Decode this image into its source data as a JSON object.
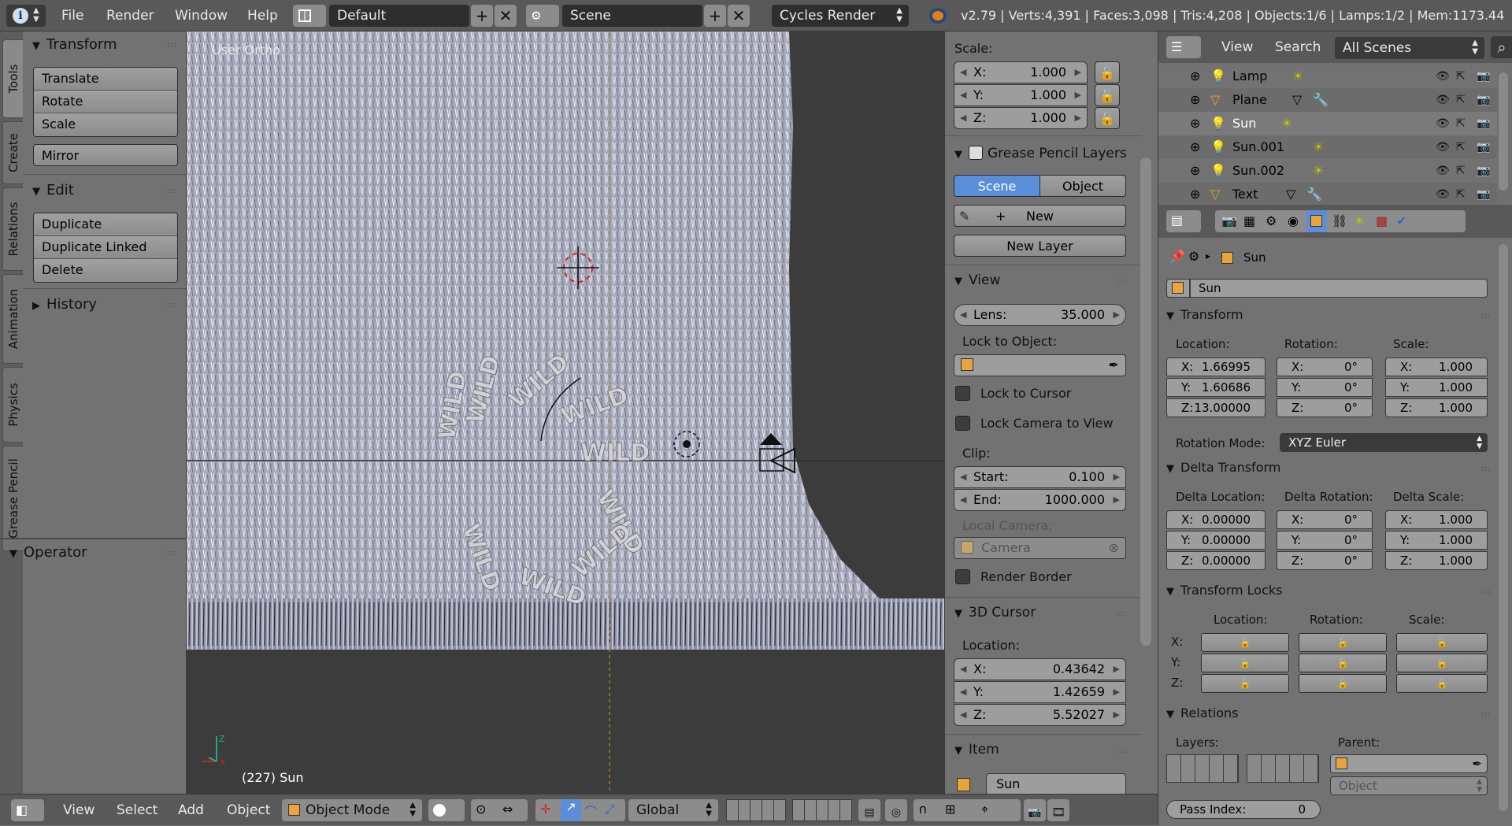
{
  "topbar": {
    "menus": [
      "File",
      "Render",
      "Window",
      "Help"
    ],
    "layout": "Default",
    "scene": "Scene",
    "engine": "Cycles Render",
    "stats": "v2.79 | Verts:4,391 | Faces:3,098 | Tris:4,208 | Objects:1/6 | Lamps:1/2 | Mem:1173.44"
  },
  "tool_tabs": [
    "Tools",
    "Create",
    "Relations",
    "Animation",
    "Physics",
    "Grease Pencil"
  ],
  "tools": {
    "transform_title": "Transform",
    "translate": "Translate",
    "rotate": "Rotate",
    "scale": "Scale",
    "mirror": "Mirror",
    "edit_title": "Edit",
    "duplicate": "Duplicate",
    "duplicate_linked": "Duplicate Linked",
    "delete": "Delete",
    "history_title": "History",
    "operator_title": "Operator"
  },
  "viewport": {
    "view_label": "User Ortho",
    "frame_info": "(227) Sun",
    "text_object": "WILD"
  },
  "nprops": {
    "scale_label": "Scale:",
    "scale_x": "1.000",
    "scale_y": "1.000",
    "scale_z": "1.000",
    "gp_title": "Grease Pencil Layers",
    "gp_scene": "Scene",
    "gp_object": "Object",
    "gp_new": "New",
    "gp_new_layer": "New Layer",
    "view_title": "View",
    "lens_label": "Lens:",
    "lens_value": "35.000",
    "lock_obj_label": "Lock to Object:",
    "lock_cursor": "Lock to Cursor",
    "lock_camera": "Lock Camera to View",
    "clip_label": "Clip:",
    "clip_start_label": "Start:",
    "clip_start": "0.100",
    "clip_end_label": "End:",
    "clip_end": "1000.000",
    "local_camera": "Local Camera:",
    "camera": "Camera",
    "render_border": "Render Border",
    "cursor_title": "3D Cursor",
    "location_label": "Location:",
    "cursor_x": "0.43642",
    "cursor_y": "1.42659",
    "cursor_z": "5.52027",
    "item_title": "Item",
    "item_name": "Sun"
  },
  "outliner": {
    "view": "View",
    "search": "Search",
    "filter": "All Scenes",
    "items": [
      "Lamp",
      "Plane",
      "Sun",
      "Sun.001",
      "Sun.002",
      "Text"
    ]
  },
  "props": {
    "breadcrumb_obj": "Sun",
    "name": "Sun",
    "transform_title": "Transform",
    "location_label": "Location:",
    "rotation_label": "Rotation:",
    "scale_label": "Scale:",
    "loc_x": "1.66995",
    "loc_y": "1.60686",
    "loc_z": "13.00000",
    "rot_x": "0°",
    "rot_y": "0°",
    "rot_z": "0°",
    "scl_x": "1.000",
    "scl_y": "1.000",
    "scl_z": "1.000",
    "rotation_mode_label": "Rotation Mode:",
    "rotation_mode": "XYZ Euler",
    "delta_title": "Delta Transform",
    "delta_location": "Delta Location:",
    "delta_rotation": "Delta Rotation:",
    "delta_scale": "Delta Scale:",
    "dloc_x": "0.00000",
    "dloc_y": "0.00000",
    "dloc_z": "0.00000",
    "drot_x": "0°",
    "drot_y": "0°",
    "drot_z": "0°",
    "dscl_x": "1.000",
    "dscl_y": "1.000",
    "dscl_z": "1.000",
    "locks_title": "Transform Locks",
    "relations_title": "Relations",
    "layers_label": "Layers:",
    "parent_label": "Parent:",
    "parent_type": "Object",
    "pass_index_label": "Pass Index:",
    "pass_index": "0"
  },
  "axes": {
    "x": "X:",
    "y": "Y:",
    "z": "Z:"
  },
  "bottombar": {
    "view": "View",
    "select": "Select",
    "add": "Add",
    "object": "Object",
    "mode": "Object Mode",
    "orientation": "Global"
  }
}
